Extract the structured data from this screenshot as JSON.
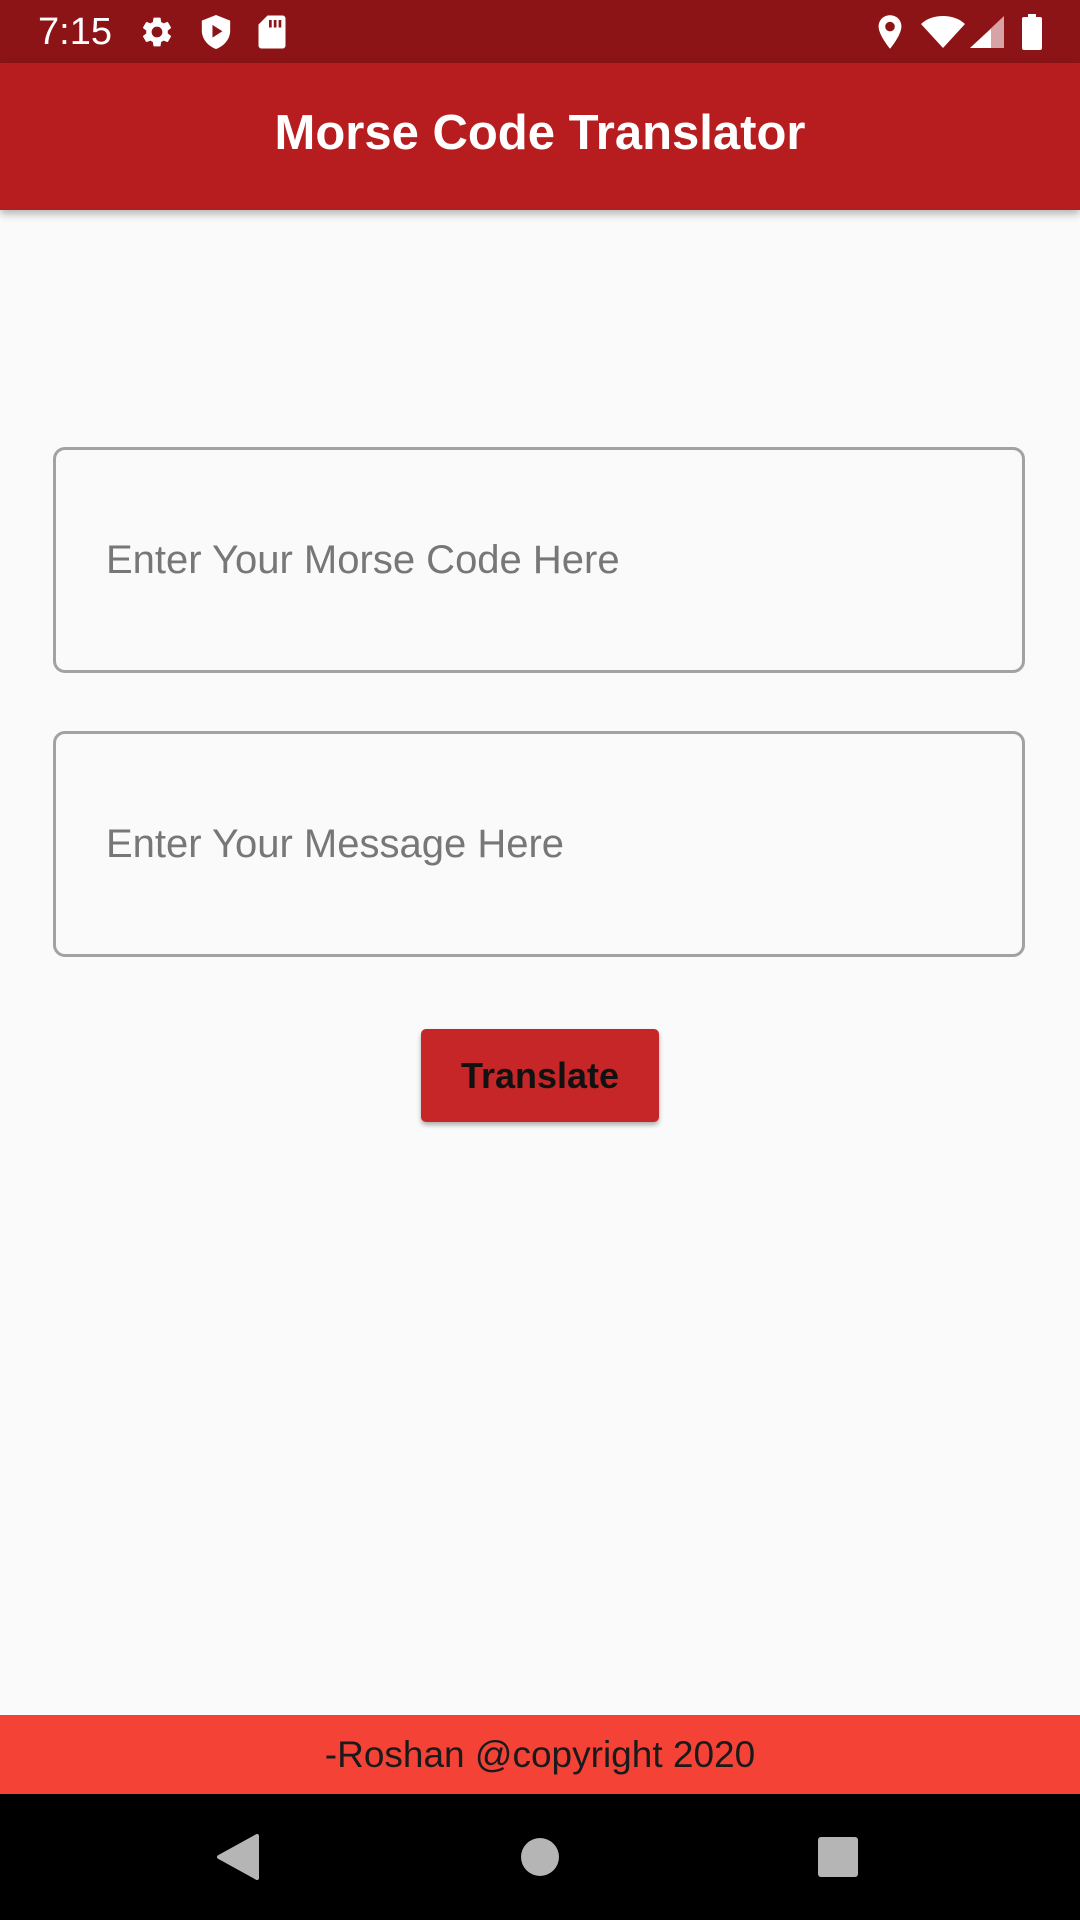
{
  "status_bar": {
    "time": "7:15",
    "left_icons": [
      "gear-icon",
      "shield-play-icon",
      "sd-card-icon"
    ],
    "right_icons": [
      "location-pin-icon",
      "wifi-icon",
      "cell-signal-icon",
      "battery-icon"
    ]
  },
  "app_bar": {
    "title": "Morse Code Translator",
    "color": "#b71c1f"
  },
  "form": {
    "morse_input": {
      "placeholder": "Enter Your Morse Code Here",
      "value": ""
    },
    "message_input": {
      "placeholder": "Enter Your Message Here",
      "value": ""
    },
    "translate_label": "Translate",
    "button_color": "#c62628"
  },
  "footer": {
    "text": "-Roshan @copyright 2020",
    "color": "#f44336"
  },
  "nav_bar": {
    "buttons": [
      "back-icon",
      "home-icon",
      "recents-icon"
    ]
  }
}
